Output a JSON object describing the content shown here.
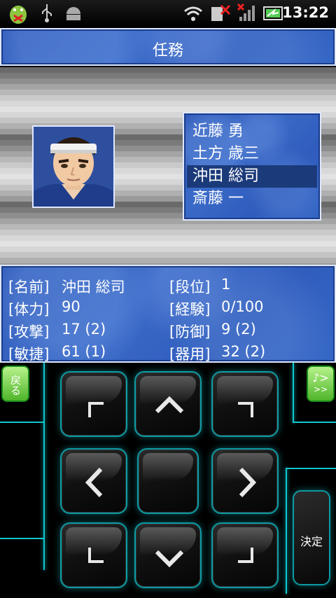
{
  "status_bar": {
    "time": "13:22",
    "icons": [
      "android-bug-icon",
      "usb-icon",
      "android-icon",
      "wifi-icon",
      "sim-error-icon",
      "signal-icon",
      "battery-icon"
    ]
  },
  "title": "任務",
  "members": [
    {
      "name": "近藤 勇",
      "selected": false
    },
    {
      "name": "土方 歳三",
      "selected": false
    },
    {
      "name": "沖田 総司",
      "selected": true
    },
    {
      "name": "斎藤 一",
      "selected": false
    }
  ],
  "stats": {
    "name_label": "[名前]",
    "name_value": "沖田 総司",
    "rank_label": "[段位]",
    "rank_value": "1",
    "hp_label": "[体力]",
    "hp_value": "90",
    "exp_label": "[経験]",
    "exp_value": "0/100",
    "atk_label": "[攻撃]",
    "atk_value": "17 (2)",
    "def_label": "[防御]",
    "def_value": "9 (2)",
    "agi_label": "[敏捷]",
    "agi_value": "61 (1)",
    "dex_label": "[器用]",
    "dex_value": "32 (2)"
  },
  "controller": {
    "back_label": "戻る",
    "music_label": "♪>",
    "music_sub_label": ">>",
    "decide_label": "決定"
  },
  "colors": {
    "window_blue": "#2f5cbd",
    "neon_cyan": "#0fc6cf",
    "side_button_green": "#4fb52a"
  }
}
